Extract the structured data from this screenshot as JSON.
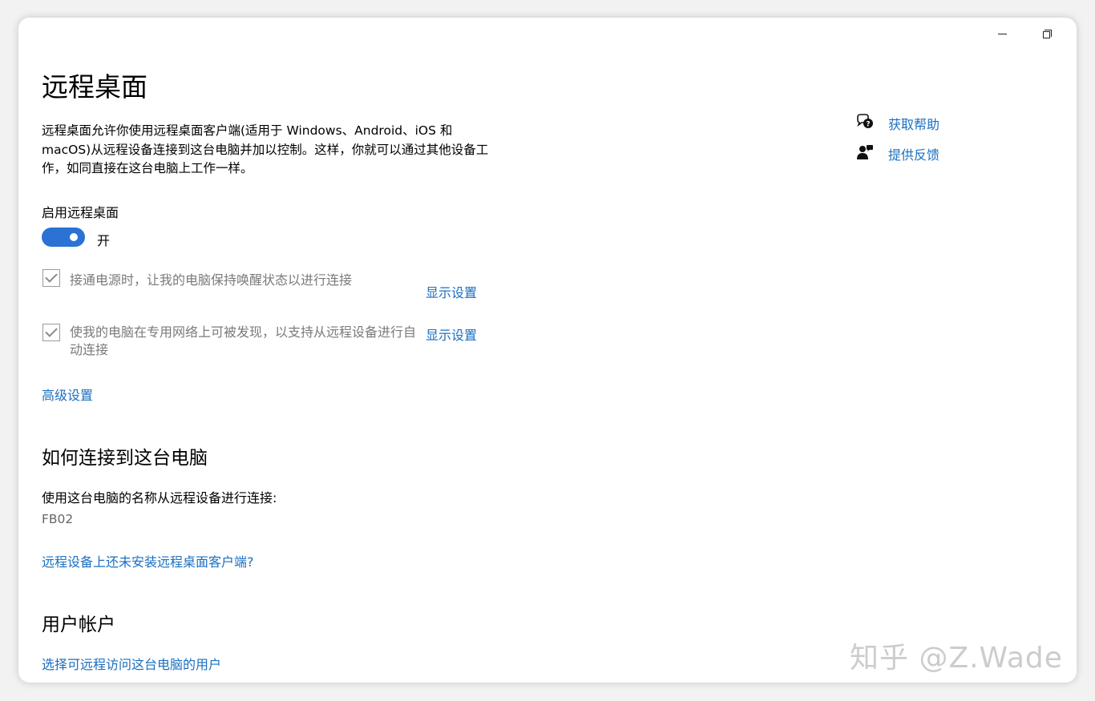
{
  "window_controls": {
    "minimize": "minimize",
    "restore": "restore"
  },
  "page": {
    "title": "远程桌面",
    "description": "远程桌面允许你使用远程桌面客户端(适用于 Windows、Android、iOS 和 macOS)从远程设备连接到这台电脑并加以控制。这样，你就可以通过其他设备工作，如同直接在这台电脑上工作一样。"
  },
  "enable_section": {
    "label": "启用远程桌面",
    "toggle_state_label": "开",
    "toggle_on": true,
    "accent_color": "#2a72d4"
  },
  "options": [
    {
      "label": "接通电源时，让我的电脑保持唤醒状态以进行连接",
      "checked": true,
      "link": "显示设置"
    },
    {
      "label": "使我的电脑在专用网络上可被发现，以支持从远程设备进行自动连接",
      "checked": true,
      "link": "显示设置"
    }
  ],
  "advanced_link": "高级设置",
  "connect_section": {
    "heading": "如何连接到这台电脑",
    "description": "使用这台电脑的名称从远程设备进行连接:",
    "pc_name": "FB02",
    "client_link": "远程设备上还未安装远程桌面客户端?"
  },
  "users_section": {
    "heading": "用户帐户",
    "link": "选择可远程访问这台电脑的用户"
  },
  "sidebar_links": {
    "help": {
      "label": "获取帮助",
      "icon": "help-chat-icon"
    },
    "feedback": {
      "label": "提供反馈",
      "icon": "feedback-person-icon"
    }
  },
  "watermark": "知乎 @Z.Wade",
  "colors": {
    "link": "#1a6fc0",
    "muted_text": "#7a7a7a"
  }
}
